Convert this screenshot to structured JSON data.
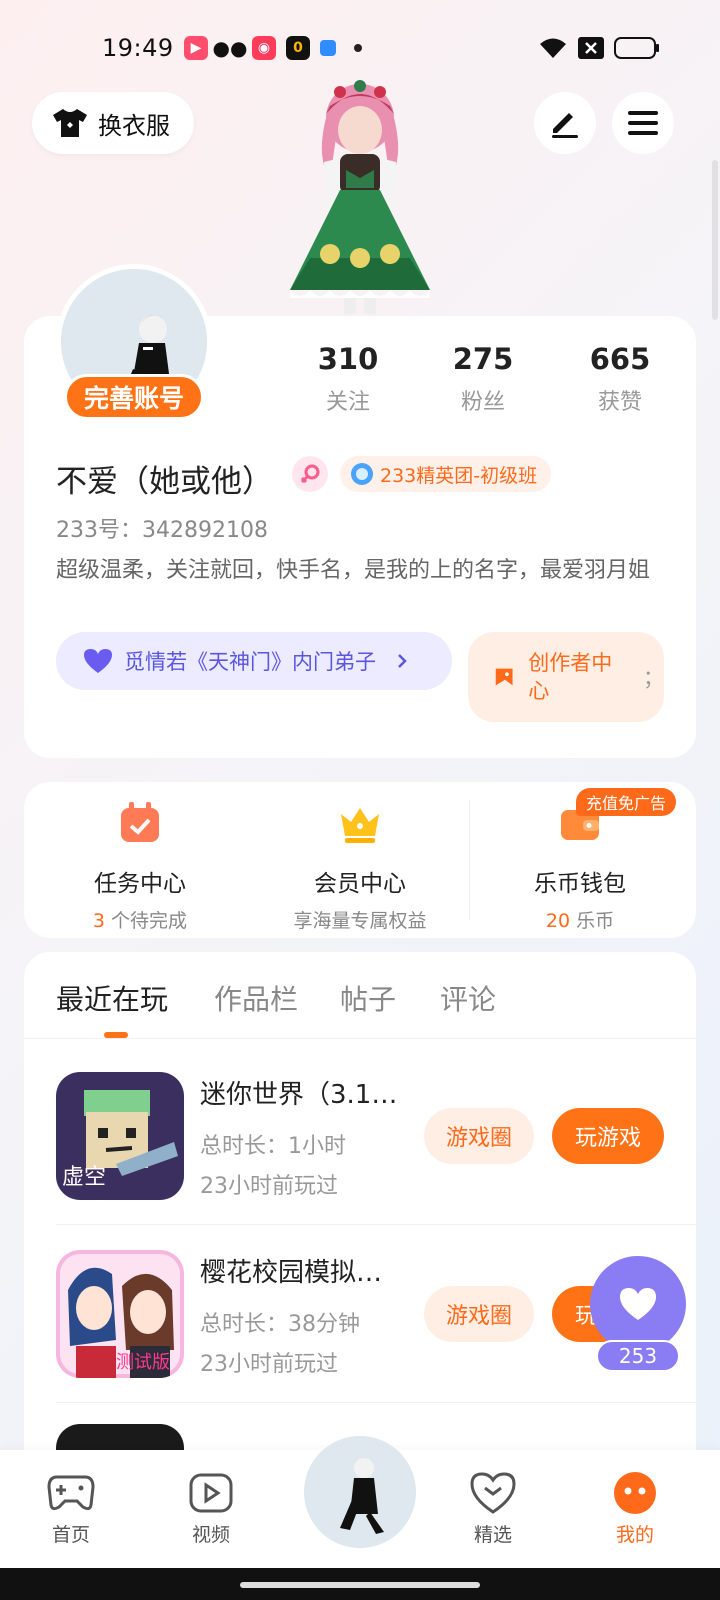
{
  "status_bar": {
    "time": "19:49"
  },
  "header": {
    "outfit_label": "换衣服"
  },
  "profile": {
    "complete_label": "完善账号",
    "stats": [
      {
        "num": "310",
        "label": "关注"
      },
      {
        "num": "275",
        "label": "粉丝"
      },
      {
        "num": "665",
        "label": "获赞"
      }
    ],
    "username": "不爱（她或他）",
    "elite_badge": "233精英团-初级班",
    "user_id": "233号：342892108",
    "bio": "超级温柔，关注就回，快手名，是我的上的名字，最爱羽月姐",
    "sect_label": "觅情若《天神门》内门弟子",
    "creator_label": "创作者中心",
    "creator_suffix": "；"
  },
  "quick": {
    "tasks": {
      "title": "任务中心",
      "count": "3",
      "suffix": " 个待完成"
    },
    "vip": {
      "title": "会员中心",
      "sub": "享海量专属权益"
    },
    "wallet": {
      "title": "乐币钱包",
      "count": "20",
      "suffix": " 乐币",
      "tag": "充值免广告"
    }
  },
  "tabs": [
    "最近在玩",
    "作品栏",
    "帖子",
    "评论"
  ],
  "games": [
    {
      "title": "迷你世界（3.1…",
      "duration": "总时长：1小时",
      "last_played": "23小时前玩过",
      "circle_label": "游戏圈",
      "play_label": "玩游戏",
      "icon_text": "虚空"
    },
    {
      "title": "樱花校园模拟…",
      "duration": "总时长：38分钟",
      "last_played": "23小时前玩过",
      "circle_label": "游戏圈",
      "play_label": "玩游戏",
      "icon_text": "测试版"
    }
  ],
  "float_like": {
    "count": "253"
  },
  "nav": [
    {
      "label": "首页",
      "icon": "gamepad-icon"
    },
    {
      "label": "视频",
      "icon": "video-icon"
    },
    {
      "label": "精选",
      "icon": "heart-box-icon"
    },
    {
      "label": "我的",
      "icon": "face-icon"
    }
  ],
  "colors": {
    "accent": "#ff7215",
    "purple": "#8a7cf2"
  }
}
